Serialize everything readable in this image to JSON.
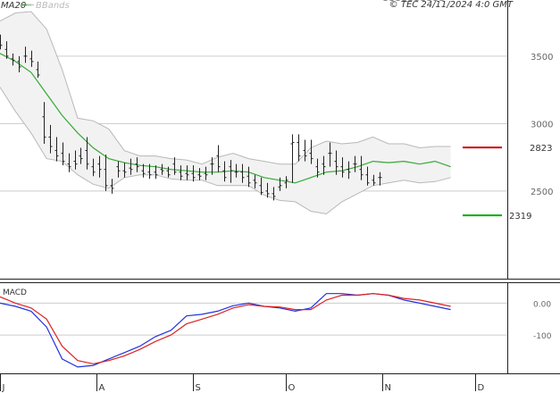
{
  "header": {
    "legend_ma": "MA20",
    "legend_bb": "BBands",
    "copyright": "© TEC 24/11/2024 4:0 GMT"
  },
  "macd_panel": {
    "label": "MACD"
  },
  "colors": {
    "ma": "#33aa33",
    "bands": "#b8b8b8",
    "band_fill": "#f2f2f2",
    "price": "#222222",
    "macd": "#2233dd",
    "signal": "#dd2222",
    "resistance": "#cc0000",
    "support": "#00aa00",
    "grid": "#cccccc"
  },
  "chart_data": [
    {
      "type": "line",
      "title": "",
      "y_ticks": [
        "3500",
        "3000",
        "2500"
      ],
      "y_tick_values": [
        3500,
        3000,
        2500
      ],
      "ylim": [
        1850,
        3850
      ],
      "x_ticks": [
        "J",
        "A",
        "S",
        "O",
        "N",
        "D"
      ],
      "x_tick_values": [
        0,
        31,
        62,
        92,
        123,
        153
      ],
      "xlim": [
        0,
        160
      ],
      "levels": [
        {
          "name": "resistance",
          "value": 2823,
          "label": "2823"
        },
        {
          "name": "support",
          "value": 2319,
          "label": "2319"
        }
      ],
      "ohlc": {
        "x": [
          0,
          2,
          4,
          6,
          8,
          10,
          12,
          14,
          16,
          18,
          20,
          22,
          24,
          26,
          28,
          30,
          32,
          34,
          36,
          38,
          40,
          42,
          44,
          46,
          48,
          50,
          52,
          54,
          56,
          58,
          60,
          62,
          64,
          66,
          68,
          70,
          72,
          74,
          76,
          78,
          80,
          82,
          84,
          86,
          88,
          90,
          92,
          94,
          96,
          98,
          100,
          102,
          104,
          106,
          108,
          110,
          112,
          114,
          116,
          118,
          120,
          122,
          124,
          126,
          128,
          130,
          132,
          134,
          136,
          138,
          140,
          142
        ],
        "high": [
          3660,
          3610,
          3520,
          3500,
          3570,
          3540,
          3460,
          3160,
          2990,
          2900,
          2860,
          2780,
          2800,
          2820,
          2900,
          2740,
          2760,
          2770,
          2590,
          2720,
          2710,
          2740,
          2750,
          2700,
          2700,
          2690,
          2700,
          2680,
          2750,
          2690,
          2690,
          2690,
          2670,
          2680,
          2750,
          2840,
          2720,
          2730,
          2700,
          2700,
          2680,
          2620,
          2600,
          2560,
          2530,
          2600,
          2610,
          2920,
          2920,
          2880,
          2880,
          2740,
          2760,
          2860,
          2800,
          2750,
          2720,
          2760,
          2760,
          2680,
          2620,
          2640
        ],
        "low": [
          3550,
          3480,
          3430,
          3380,
          3450,
          3420,
          3340,
          2850,
          2780,
          2720,
          2690,
          2640,
          2660,
          2700,
          2660,
          2610,
          2600,
          2500,
          2480,
          2600,
          2600,
          2620,
          2640,
          2600,
          2590,
          2590,
          2620,
          2600,
          2620,
          2580,
          2580,
          2570,
          2580,
          2580,
          2620,
          2640,
          2570,
          2560,
          2600,
          2560,
          2530,
          2520,
          2470,
          2450,
          2430,
          2500,
          2520,
          2560,
          2720,
          2720,
          2700,
          2600,
          2620,
          2680,
          2620,
          2600,
          2590,
          2640,
          2580,
          2540,
          2540,
          2540
        ],
        "open": [
          3620,
          3550,
          3480,
          3460,
          3500,
          3480,
          3400,
          3050,
          2900,
          2800,
          2780,
          2700,
          2720,
          2760,
          2800,
          2680,
          2700,
          2660,
          2540,
          2680,
          2650,
          2670,
          2700,
          2650,
          2640,
          2640,
          2660,
          2650,
          2700,
          2640,
          2630,
          2630,
          2620,
          2630,
          2700,
          2760,
          2650,
          2680,
          2640,
          2640,
          2610,
          2580,
          2540,
          2500,
          2480,
          2530,
          2560,
          2850,
          2860,
          2800,
          2780,
          2680,
          2700,
          2780,
          2720,
          2680,
          2660,
          2700,
          2660,
          2620,
          2580,
          2600
        ],
        "close": [
          3580,
          3500,
          3470,
          3420,
          3500,
          3460,
          3360,
          2900,
          2830,
          2760,
          2720,
          2680,
          2700,
          2740,
          2700,
          2640,
          2660,
          2540,
          2520,
          2650,
          2640,
          2660,
          2680,
          2630,
          2620,
          2620,
          2650,
          2620,
          2640,
          2610,
          2620,
          2600,
          2610,
          2620,
          2700,
          2680,
          2600,
          2650,
          2640,
          2600,
          2560,
          2560,
          2490,
          2480,
          2460,
          2540,
          2580,
          2860,
          2760,
          2760,
          2740,
          2640,
          2680,
          2780,
          2680,
          2640,
          2640,
          2700,
          2620,
          2560,
          2560,
          2600
        ]
      },
      "series": [
        {
          "name": "MA20",
          "x": [
            0,
            5,
            10,
            15,
            20,
            25,
            30,
            35,
            40,
            45,
            50,
            55,
            60,
            65,
            70,
            75,
            80,
            85,
            90,
            95,
            100,
            105,
            110,
            115,
            120,
            125,
            130,
            135,
            140,
            145
          ],
          "y": [
            3520,
            3460,
            3380,
            3220,
            3060,
            2930,
            2820,
            2740,
            2710,
            2690,
            2680,
            2660,
            2650,
            2640,
            2640,
            2650,
            2640,
            2600,
            2580,
            2560,
            2600,
            2640,
            2650,
            2680,
            2720,
            2710,
            2720,
            2700,
            2720,
            2680
          ]
        },
        {
          "name": "BBands upper",
          "x": [
            0,
            5,
            10,
            15,
            20,
            25,
            30,
            35,
            40,
            45,
            50,
            55,
            60,
            65,
            70,
            75,
            80,
            85,
            90,
            95,
            100,
            105,
            110,
            115,
            120,
            125,
            130,
            135,
            140,
            145
          ],
          "y": [
            3760,
            3820,
            3830,
            3700,
            3400,
            3040,
            3020,
            2960,
            2800,
            2760,
            2760,
            2740,
            2730,
            2700,
            2750,
            2780,
            2740,
            2720,
            2700,
            2700,
            2820,
            2870,
            2850,
            2860,
            2900,
            2850,
            2850,
            2820,
            2830,
            2830
          ]
        },
        {
          "name": "BBands lower",
          "x": [
            0,
            5,
            10,
            15,
            20,
            25,
            30,
            35,
            40,
            45,
            50,
            55,
            60,
            65,
            70,
            75,
            80,
            85,
            90,
            95,
            100,
            105,
            110,
            115,
            120,
            125,
            130,
            135,
            140,
            145
          ],
          "y": [
            3270,
            3090,
            2930,
            2740,
            2720,
            2620,
            2550,
            2520,
            2600,
            2620,
            2620,
            2590,
            2580,
            2580,
            2540,
            2540,
            2540,
            2470,
            2430,
            2420,
            2350,
            2330,
            2420,
            2480,
            2540,
            2560,
            2580,
            2560,
            2570,
            2600
          ]
        }
      ]
    },
    {
      "type": "line",
      "title": "MACD",
      "y_ticks": [
        "0.00",
        "-100"
      ],
      "y_tick_values": [
        0,
        -100
      ],
      "ylim": [
        -220,
        60
      ],
      "xlim": [
        0,
        160
      ],
      "series": [
        {
          "name": "MACD",
          "x": [
            0,
            5,
            10,
            15,
            20,
            25,
            30,
            35,
            40,
            45,
            50,
            55,
            60,
            65,
            70,
            75,
            80,
            85,
            90,
            95,
            100,
            105,
            110,
            115,
            120,
            125,
            130,
            135,
            140,
            145
          ],
          "y": [
            0,
            -10,
            -25,
            -75,
            -175,
            -200,
            -195,
            -175,
            -155,
            -135,
            -105,
            -85,
            -40,
            -35,
            -25,
            -8,
            0,
            -10,
            -15,
            -25,
            -15,
            30,
            30,
            25,
            30,
            25,
            10,
            0,
            -10,
            -20
          ]
        },
        {
          "name": "Signal",
          "x": [
            0,
            5,
            10,
            15,
            20,
            25,
            30,
            35,
            40,
            45,
            50,
            55,
            60,
            65,
            70,
            75,
            80,
            85,
            90,
            95,
            100,
            105,
            110,
            115,
            120,
            125,
            130,
            135,
            140,
            145
          ],
          "y": [
            20,
            0,
            -15,
            -50,
            -135,
            -180,
            -190,
            -180,
            -165,
            -145,
            -120,
            -100,
            -65,
            -50,
            -35,
            -15,
            -5,
            -10,
            -12,
            -20,
            -20,
            10,
            25,
            25,
            30,
            25,
            15,
            10,
            0,
            -10
          ]
        }
      ]
    }
  ]
}
